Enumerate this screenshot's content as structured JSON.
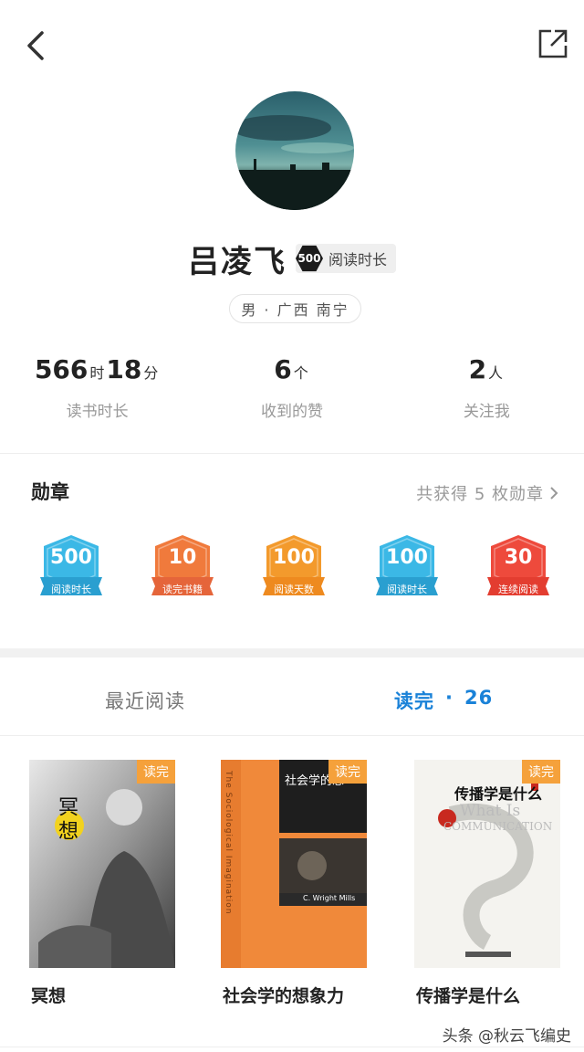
{
  "profile": {
    "name": "吕凌飞",
    "level_badge": {
      "number": "500",
      "label": "阅读时长"
    },
    "location": "男 · 广西 南宁"
  },
  "stats": {
    "reading_time": {
      "hours": "566",
      "hours_unit": "时",
      "minutes": "18",
      "minutes_unit": "分",
      "label": "读书时长"
    },
    "likes": {
      "value": "6",
      "unit": "个",
      "label": "收到的赞"
    },
    "followers": {
      "value": "2",
      "unit": "人",
      "label": "关注我"
    }
  },
  "medals_section": {
    "title": "勋章",
    "summary": "共获得 5 枚勋章",
    "items": [
      {
        "number": "500",
        "label": "阅读时长",
        "color": "#3bb8e6",
        "ribbon": "#2a9fd0"
      },
      {
        "number": "10",
        "label": "读完书籍",
        "color": "#f07a3c",
        "ribbon": "#e5653a"
      },
      {
        "number": "100",
        "label": "阅读天数",
        "color": "#f39a2c",
        "ribbon": "#ee8a1f"
      },
      {
        "number": "100",
        "label": "阅读时长",
        "color": "#3bb8e6",
        "ribbon": "#2a9fd0"
      },
      {
        "number": "30",
        "label": "连续阅读",
        "color": "#ee4a3c",
        "ribbon": "#e33d30"
      }
    ]
  },
  "tabs": {
    "recent": "最近阅读",
    "finished_label": "读完",
    "finished_sep": "·",
    "finished_count": "26"
  },
  "books": [
    {
      "title": "冥想",
      "tag": "读完",
      "cover_text": "冥想"
    },
    {
      "title": "社会学的想象力",
      "tag": "读完",
      "cover_text": "社会学的想",
      "cover_spine": "The Sociological Imagination",
      "cover_author": "C. Wright Mills"
    },
    {
      "title": "传播学是什么",
      "tag": "读完",
      "cover_text": "传播学是什么",
      "cover_en1": "What Is",
      "cover_en2": "COMMUNICATION"
    }
  ],
  "watermark": "头条 @秋云飞编史",
  "colors": {
    "accent": "#1a82d8",
    "done_tag": "#f5a13b"
  },
  "icons": {
    "back": "chevron-left-icon",
    "share": "share-external-icon"
  }
}
